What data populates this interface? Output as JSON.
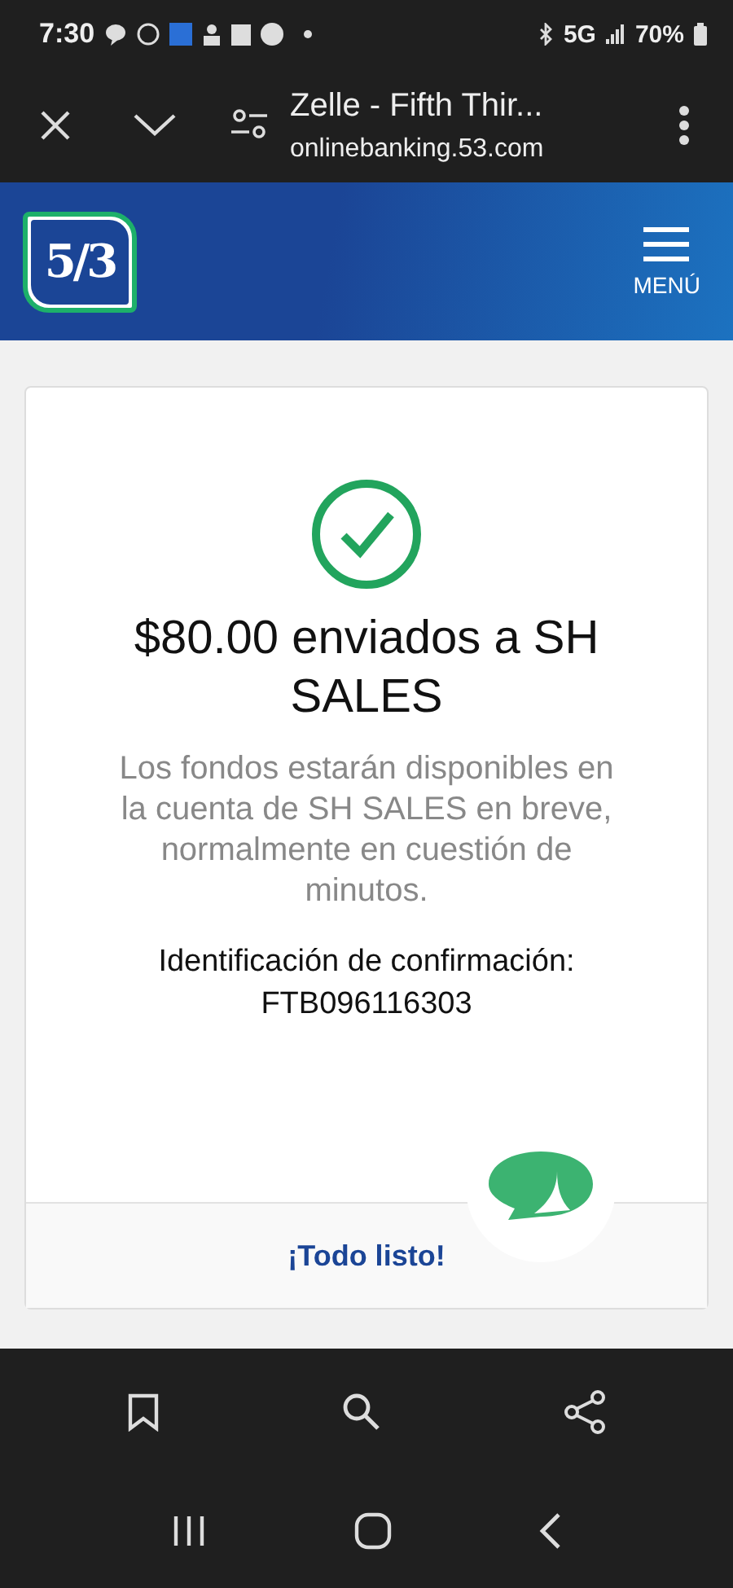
{
  "status_bar": {
    "time": "7:30",
    "network": "5G",
    "battery": "70%"
  },
  "browser": {
    "title": "Zelle - Fifth Thir...",
    "url": "onlinebanking.53.com"
  },
  "header": {
    "logo": "5/3",
    "menu_label": "MENÚ"
  },
  "confirmation": {
    "headline": "$80.00 enviados a SH SALES",
    "message": "Los fondos estarán disponibles en la cuenta de SH SALES en breve, normalmente en cuestión de minutos.",
    "id_label": "Identificación de confirmación:",
    "id_value": "FTB096116303",
    "done_link": "¡Todo listo!"
  }
}
